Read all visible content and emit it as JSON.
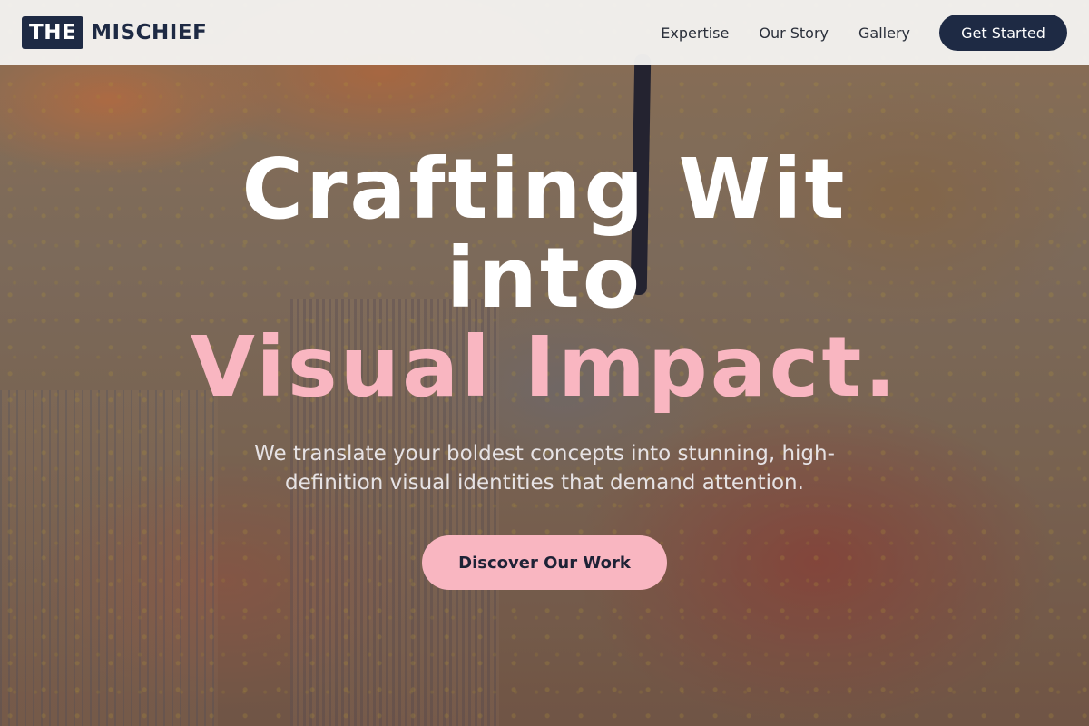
{
  "brand": {
    "logo_box": "THE",
    "logo_text": "MISCHIEF"
  },
  "nav": {
    "items": [
      {
        "label": "Expertise"
      },
      {
        "label": "Our Story"
      },
      {
        "label": "Gallery"
      }
    ],
    "cta_label": "Get Started"
  },
  "hero": {
    "headline_line1": "Crafting Wit",
    "headline_line2": "into",
    "headline_line3": "Visual Impact.",
    "subtitle": "We translate your boldest concepts into stunning, high-definition visual identities that demand attention.",
    "button_label": "Discover Our Work"
  },
  "colors": {
    "navy": "#1e2a44",
    "pink_accent": "#f9b6c1",
    "header_bg": "#f4f2f0"
  }
}
